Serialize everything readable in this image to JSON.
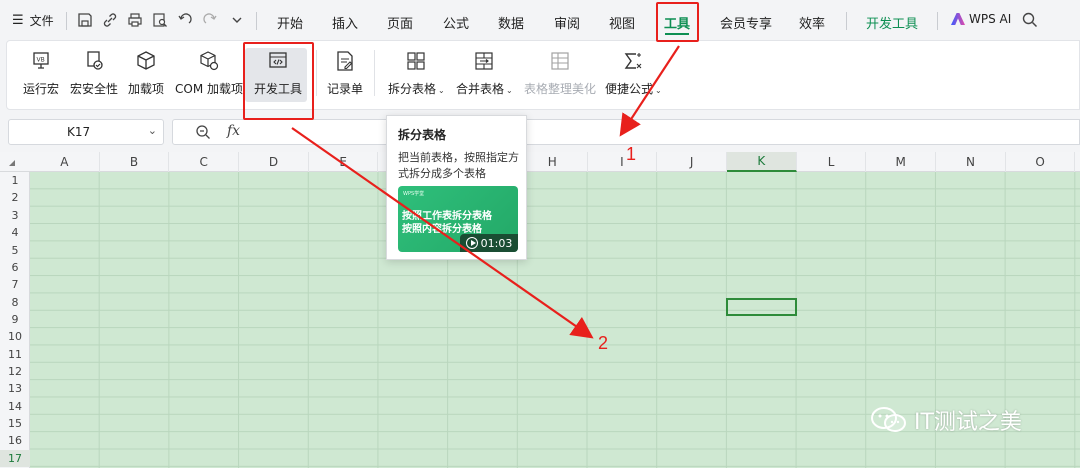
{
  "menu": {
    "file_label": "文件",
    "tabs": [
      {
        "label": "开始"
      },
      {
        "label": "插入"
      },
      {
        "label": "页面"
      },
      {
        "label": "公式"
      },
      {
        "label": "数据"
      },
      {
        "label": "审阅"
      },
      {
        "label": "视图"
      },
      {
        "label": "工具"
      },
      {
        "label": "会员专享"
      },
      {
        "label": "效率"
      },
      {
        "label": "开发工具"
      }
    ],
    "active_tab": "工具",
    "wps_ai": "WPS AI"
  },
  "ribbon": {
    "buttons": [
      {
        "label": "运行宏",
        "icon": "run-macro-icon"
      },
      {
        "label": "宏安全性",
        "icon": "macro-security-icon"
      },
      {
        "label": "加载项",
        "icon": "addin-cube-icon"
      },
      {
        "label": "COM 加载项",
        "icon": "com-addin-icon"
      },
      {
        "label": "开发工具",
        "icon": "developer-code-icon"
      },
      {
        "label": "记录单",
        "icon": "record-form-icon"
      },
      {
        "label": "拆分表格",
        "icon": "split-table-icon"
      },
      {
        "label": "合并表格",
        "icon": "merge-table-icon"
      },
      {
        "label": "表格整理美化",
        "icon": "table-beautify-icon"
      },
      {
        "label": "便捷公式",
        "icon": "sigma-icon"
      }
    ]
  },
  "formula_bar": {
    "name_box": "K17",
    "fx": "fx"
  },
  "grid": {
    "columns": [
      "A",
      "B",
      "C",
      "D",
      "E",
      "F",
      "G",
      "H",
      "I",
      "J",
      "K",
      "L",
      "M",
      "N",
      "O"
    ],
    "rows": [
      "1",
      "2",
      "3",
      "4",
      "5",
      "6",
      "7",
      "8",
      "9",
      "10",
      "11",
      "12",
      "13",
      "14",
      "15",
      "16",
      "17"
    ],
    "selected_cell": "K17"
  },
  "tooltip": {
    "title": "拆分表格",
    "description": "把当前表格，按照指定方式拆分成多个表格",
    "thumb_brand": "WPS学堂",
    "thumb_line1": "按照工作表拆分表格",
    "thumb_line2": "按照内容拆分表格",
    "duration": "01:03"
  },
  "annotations": {
    "label_1": "1",
    "label_2": "2",
    "color": "#e8201c"
  },
  "watermark": "IT测试之美",
  "colors": {
    "accent": "#0e8f53",
    "sheet_fill": "#cfe8d2"
  }
}
